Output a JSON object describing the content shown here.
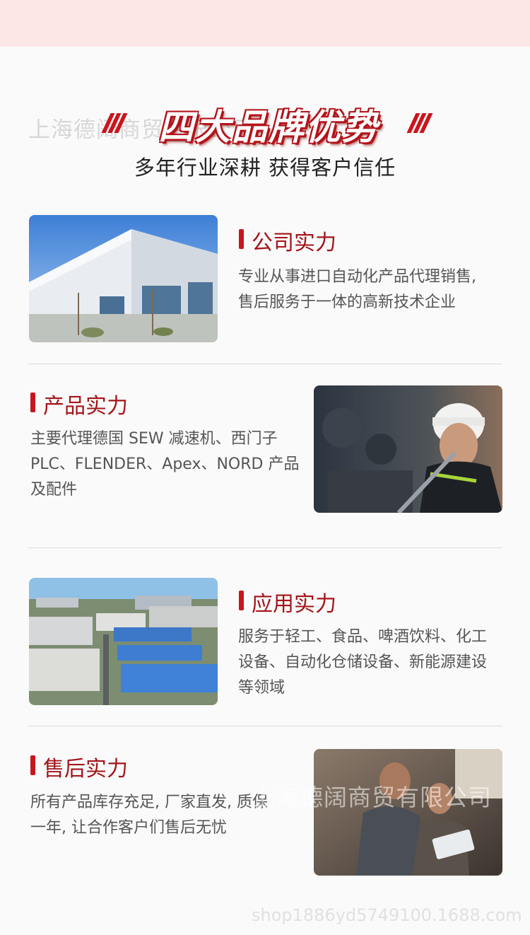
{
  "hero": {
    "title": "四大品牌优势",
    "subtitle": "多年行业深耕 获得客户信任"
  },
  "watermarks": {
    "top": "上海德阔商贸有限公司",
    "middle": "上海德阔商贸有限公司",
    "bottom": "shop1886yd5749100.1688.com"
  },
  "sections": [
    {
      "title": "公司实力",
      "description_lines": [
        "专业从事进口自动化产品代理销售,",
        "售后服务于一体的高新技术企业"
      ],
      "image_icon": "warehouse-building-photo"
    },
    {
      "title": "产品实力",
      "description_lines": [
        "主要代理德国 SEW 减速机、西门子",
        "PLC、FLENDER、Apex、NORD 产品",
        "及配件"
      ],
      "image_icon": "engineer-hardhat-photo"
    },
    {
      "title": "应用实力",
      "description_lines": [
        "服务于轻工、食品、啤酒饮料、化工",
        "设备、自动化仓储设备、新能源建设",
        "等领域"
      ],
      "image_icon": "industrial-park-aerial-photo"
    },
    {
      "title": "售后实力",
      "description_lines": [
        "所有产品库存充足, 厂家直发, 质保",
        "一年, 让合作客户们售后无忧"
      ],
      "image_icon": "workers-tablet-photo"
    }
  ],
  "colors": {
    "accent_red": "#c8161d",
    "title_red": "#a3151b",
    "top_band": "#fde6e6"
  }
}
